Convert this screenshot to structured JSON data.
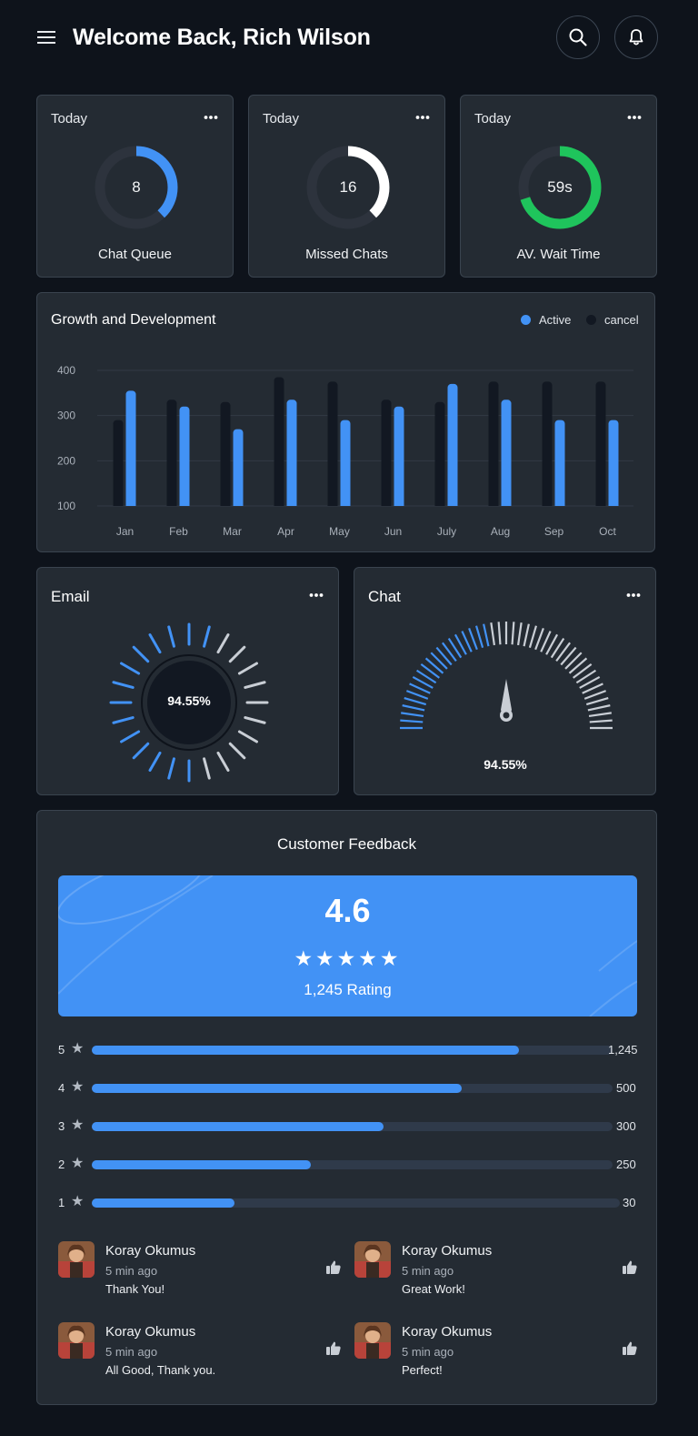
{
  "header": {
    "title": "Welcome Back, Rich Wilson",
    "icons": {
      "menu": "hamburger-menu-icon",
      "search": "search-icon",
      "notifications": "bell-icon"
    }
  },
  "kpis": [
    {
      "label": "Today",
      "value": "8",
      "caption": "Chat Queue",
      "progress": 0.38,
      "color": "#4292f5"
    },
    {
      "label": "Today",
      "value": "16",
      "caption": "Missed Chats",
      "progress": 0.38,
      "color": "#ffffff"
    },
    {
      "label": "Today",
      "value": "59s",
      "caption": "AV. Wait Time",
      "progress": 0.7,
      "color": "#1fc45c"
    }
  ],
  "growth": {
    "title": "Growth and Development",
    "legend": [
      {
        "name": "Active",
        "color": "#4292f5"
      },
      {
        "name": "cancel",
        "color": "#121822"
      }
    ]
  },
  "chart_data": {
    "type": "bar",
    "categories": [
      "Jan",
      "Feb",
      "Mar",
      "Apr",
      "May",
      "Jun",
      "July",
      "Aug",
      "Sep",
      "Oct"
    ],
    "series": [
      {
        "name": "cancel",
        "values": [
          290,
          335,
          330,
          385,
          375,
          335,
          330,
          375,
          375,
          375
        ]
      },
      {
        "name": "Active",
        "values": [
          355,
          320,
          270,
          335,
          290,
          320,
          370,
          335,
          290,
          290
        ]
      }
    ],
    "yticks": [
      100,
      200,
      300,
      400
    ],
    "ylim": [
      100,
      400
    ],
    "grid": true,
    "legend_position": "top-right"
  },
  "email_panel": {
    "title": "Email",
    "value": "94.55%",
    "percent": 94.55,
    "accent": "#4292f5"
  },
  "chat_panel": {
    "title": "Chat",
    "value": "94.55%",
    "percent": 94.55,
    "accent": "#4292f5"
  },
  "feedback": {
    "title": "Customer Feedback",
    "score": "4.6",
    "stars": "★★★★★",
    "rating_count": "1,245 Rating",
    "breakdown": [
      {
        "stars": "5",
        "count": "1,245",
        "fraction": 0.82
      },
      {
        "stars": "4",
        "count": "500",
        "fraction": 0.71
      },
      {
        "stars": "3",
        "count": "300",
        "fraction": 0.56
      },
      {
        "stars": "2",
        "count": "250",
        "fraction": 0.42
      },
      {
        "stars": "1",
        "count": "30",
        "fraction": 0.27
      }
    ],
    "reviews": [
      {
        "name": "Koray Okumus",
        "time": "5 min ago",
        "text": "Thank You!"
      },
      {
        "name": "Koray Okumus",
        "time": "5 min ago",
        "text": "Great Work!"
      },
      {
        "name": "Koray Okumus",
        "time": "5 min ago",
        "text": "All Good, Thank you."
      },
      {
        "name": "Koray Okumus",
        "time": "5 min ago",
        "text": "Perfect!"
      }
    ]
  }
}
